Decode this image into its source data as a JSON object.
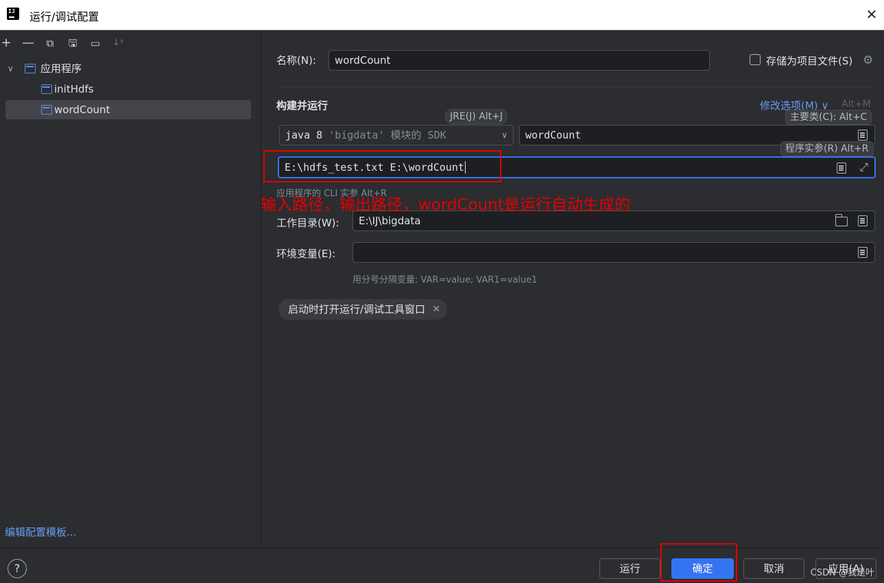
{
  "window": {
    "title": "运行/调试配置"
  },
  "toolbar": {
    "add": "+",
    "remove": "—",
    "copy": "⧉",
    "save": "🖫",
    "folder": "▭",
    "sort": "↓ᵃ"
  },
  "tree": {
    "group_label": "应用程序",
    "items": [
      {
        "label": "initHdfs"
      },
      {
        "label": "wordCount"
      }
    ],
    "edit_templates": "编辑配置模板..."
  },
  "form": {
    "name_label": "名称(N):",
    "name_value": "wordCount",
    "store_as_project_file": "存储为项目文件(S)",
    "build_and_run": "构建并运行",
    "modify_options": "修改选项(M)",
    "modify_options_shortcut": "Alt+M",
    "jre_hint": "JRE(J) Alt+J",
    "sdk_value": "java 8",
    "sdk_suffix": "'bigdata' 模块的 SDK",
    "main_class_hint": "主要类(C): Alt+C",
    "main_class_value": "wordCount",
    "program_args_hint": "程序实参(R) Alt+R",
    "program_args_value": "E:\\hdfs_test.txt E:\\wordCount",
    "cli_args_hint": "应用程序的 CLI 实参 Alt+R",
    "workdir_label": "工作目录(W):",
    "workdir_value": "E:\\IJ\\bigdata",
    "env_label": "环境变量(E):",
    "env_value": "",
    "env_hint": "用分号分隔变量: VAR=value; VAR1=value1",
    "open_tool_window_tag": "启动时打开运行/调试工具窗口"
  },
  "annotation": {
    "text": "输入路径，输出路径，wordCount是运行自动生成的",
    "color": "#e60000"
  },
  "footer": {
    "help": "?",
    "run": "运行",
    "ok": "确定",
    "cancel": "取消",
    "apply": "应用(A)",
    "watermark": "CSDN @我是叶"
  },
  "colors": {
    "accent": "#3574f0",
    "link": "#6a9bf4",
    "annotation_red": "#e60000"
  }
}
